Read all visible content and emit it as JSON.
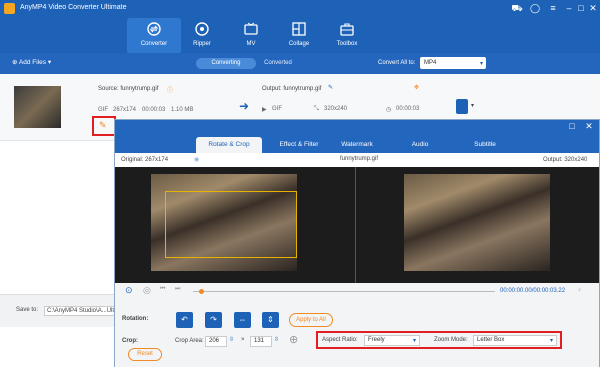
{
  "app": {
    "title": "AnyMP4 Video Converter Ultimate",
    "nav": [
      {
        "label": "Converter"
      },
      {
        "label": "Ripper"
      },
      {
        "label": "MV"
      },
      {
        "label": "Collage"
      },
      {
        "label": "Toolbox"
      }
    ],
    "add_files": "Add Files",
    "seg_converting": "Converting",
    "seg_converted": "Converted",
    "convert_all_label": "Convert All to:",
    "convert_all_format": "MP4",
    "save_to_label": "Save to:",
    "save_to_path": "C:\\AnyMP4 Studio\\A...Ult"
  },
  "file": {
    "source_label": "Source: funnytrump.gif",
    "source_format": "GIF",
    "source_resolution": "267x174",
    "source_duration": "00:00:03",
    "source_size": "1.10 MB",
    "output_label": "Output: funnytrump.gif",
    "output_format": "GIF",
    "output_resolution": "320x240",
    "output_duration": "00:00:03"
  },
  "editor": {
    "tabs": [
      "Rotate & Crop",
      "Effect & Filter",
      "Watermark",
      "Audio",
      "Subtitle"
    ],
    "original_label": "Original: 267x174",
    "file_name": "funnytrump.gif",
    "output_label": "Output: 320x240",
    "time": "00:00:00.00/00:00:03.22",
    "rotation_label": "Rotation:",
    "apply_all": "Apply to All",
    "crop_label": "Crop:",
    "crop_area_label": "Crop Area:",
    "crop_w": "206",
    "crop_h": "131",
    "times_sign": "×",
    "aspect_label": "Aspect Ratio:",
    "aspect_value": "Freely",
    "zoom_label": "Zoom Mode:",
    "zoom_value": "Letter Box",
    "reset": "Reset"
  },
  "colors": {
    "brand": "#1d62b7",
    "accent": "#f08a24",
    "highlight": "#e02020"
  }
}
